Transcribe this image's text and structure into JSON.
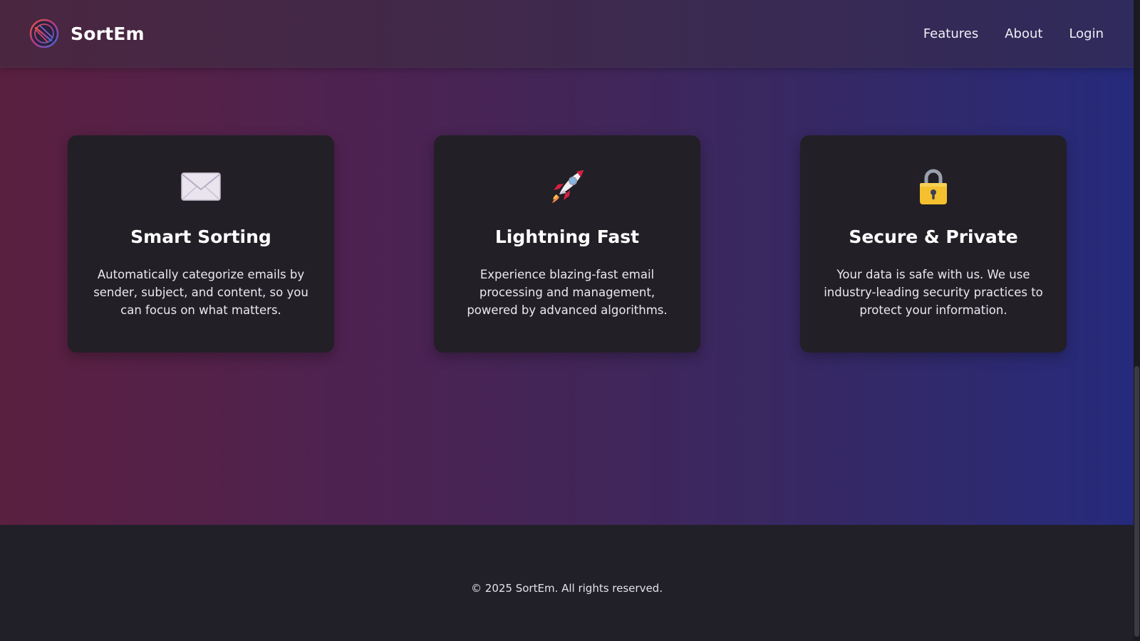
{
  "header": {
    "brand_name": "SortEm",
    "logo_icon": "sortem-logo-icon",
    "nav": [
      {
        "label": "Features"
      },
      {
        "label": "About"
      },
      {
        "label": "Login"
      }
    ]
  },
  "features": [
    {
      "icon": "envelope-icon",
      "title": "Smart Sorting",
      "description": "Automatically categorize emails by sender, subject, and content, so you can focus on what matters."
    },
    {
      "icon": "rocket-icon",
      "title": "Lightning Fast",
      "description": "Experience blazing-fast email processing and management, powered by advanced algorithms."
    },
    {
      "icon": "lock-icon",
      "title": "Secure & Private",
      "description": "Your data is safe with us. We use industry-leading security practices to protect your information."
    }
  ],
  "footer": {
    "copyright": "© 2025 SortEm. All rights reserved."
  },
  "colors": {
    "hero_left": "#5b2040",
    "hero_right": "#262a7c",
    "card_bg": "#221f26",
    "footer_bg": "#211f27"
  }
}
